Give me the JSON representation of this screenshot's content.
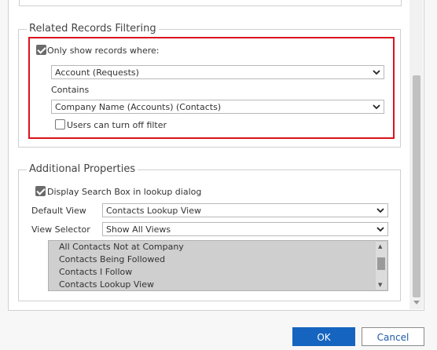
{
  "related_filtering": {
    "title": "Related Records Filtering",
    "only_show_label": "Only show records where:",
    "only_show_checked": true,
    "first_select_value": "Account (Requests)",
    "contains_label": "Contains",
    "second_select_value": "Company Name (Accounts) (Contacts)",
    "users_turn_off_label": "Users can turn off filter",
    "users_turn_off_checked": false
  },
  "additional_properties": {
    "title": "Additional Properties",
    "display_search_label": "Display Search Box in lookup dialog",
    "display_search_checked": true,
    "default_view_label": "Default View",
    "default_view_value": "Contacts Lookup View",
    "view_selector_label": "View Selector",
    "view_selector_value": "Show All Views",
    "views_list": [
      "All Contacts Not at Company",
      "Contacts Being Followed",
      "Contacts I Follow",
      "Contacts Lookup View"
    ]
  },
  "footer": {
    "ok_label": "OK",
    "cancel_label": "Cancel"
  },
  "colors": {
    "highlight": "#d9121f",
    "primary_button": "#1565c0"
  }
}
